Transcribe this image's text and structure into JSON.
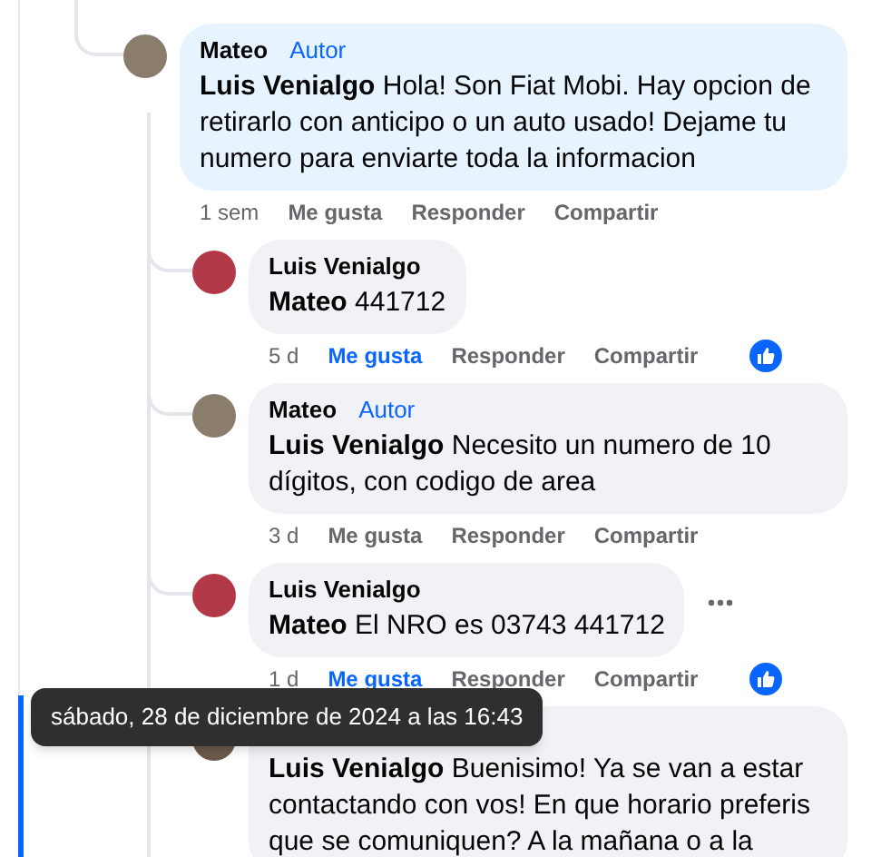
{
  "comment": {
    "author": "Mateo",
    "badge": "Autor",
    "color": "#8a7d6b",
    "mention": "Luis Venialgo",
    "text": "Hola! Son Fiat Mobi. Hay opcion de retirarlo con anticipo o un auto usado! Dejame tu numero para enviarte toda la informacion",
    "highlighted": true,
    "time": "1 sem",
    "like_label": "Me gusta",
    "liked": false,
    "reply_label": "Responder",
    "share_label": "Compartir"
  },
  "replies": [
    {
      "author": "Luis Venialgo",
      "color": "#b23a48",
      "mention": "Mateo",
      "text": "441712",
      "time": "5 d",
      "like_label": "Me gusta",
      "liked": true,
      "reply_label": "Responder",
      "share_label": "Compartir",
      "reaction": true
    },
    {
      "author": "Mateo",
      "badge": "Autor",
      "color": "#8a7d6b",
      "mention": "Luis Venialgo",
      "text": "Necesito un numero de 10 dígitos, con codigo de area",
      "time": "3 d",
      "like_label": "Me gusta",
      "liked": false,
      "reply_label": "Responder",
      "share_label": "Compartir"
    },
    {
      "author": "Luis Venialgo",
      "color": "#b23a48",
      "mention": "Mateo",
      "text": "El NRO es 03743 441712",
      "time": "1 d",
      "like_label": "Me gusta",
      "liked": true,
      "reply_label": "Responder",
      "share_label": "Compartir",
      "reaction": true,
      "more": true,
      "time_hovered": true
    },
    {
      "color": "#6b5a4a",
      "mention": "Luis Venialgo",
      "text": "Buenisimo! Ya se van a estar contactando con vos! En que horario preferis que se comuniquen? A la mañana o a la",
      "focused": true
    }
  ],
  "tooltip": {
    "text": "sábado, 28 de diciembre de 2024 a las 16:43"
  }
}
